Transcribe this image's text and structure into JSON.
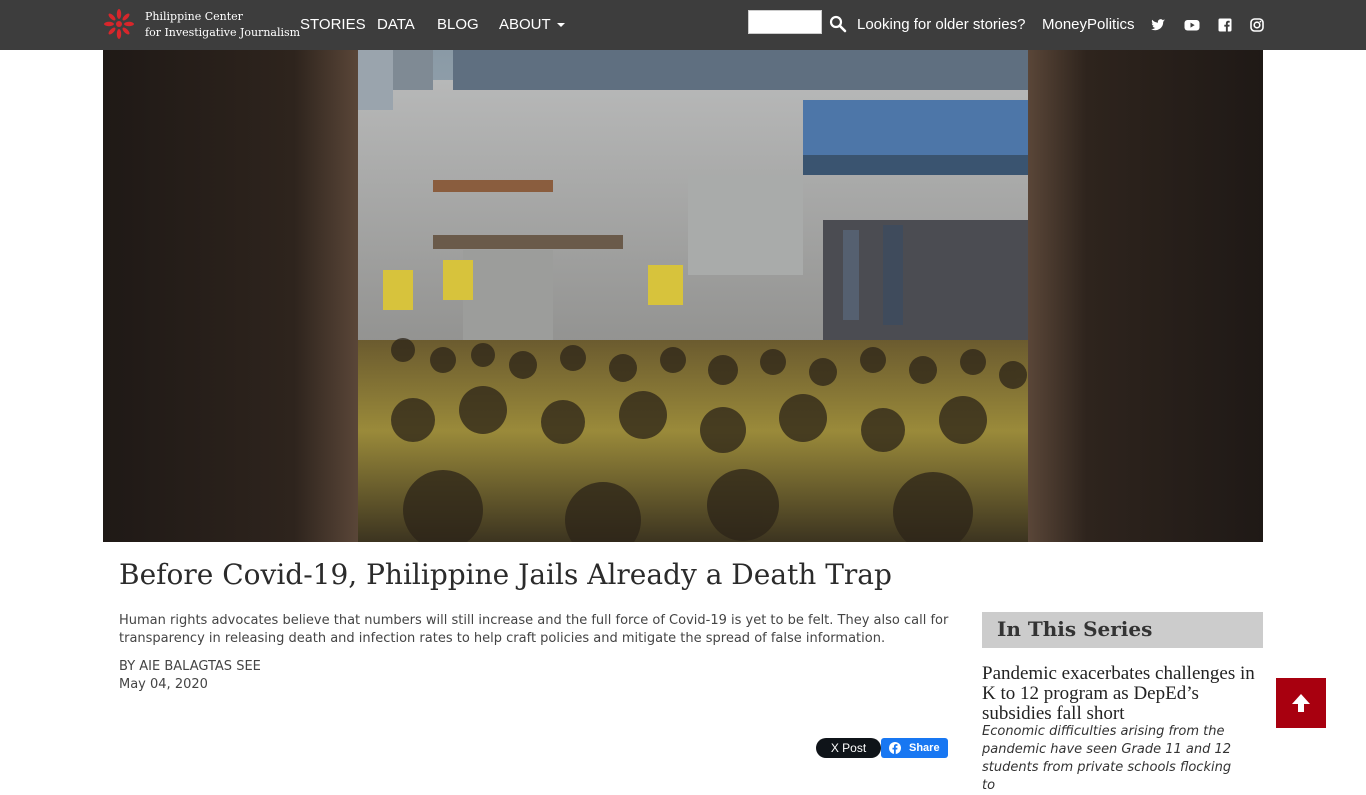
{
  "site": {
    "name_line1": "Philippine Center",
    "name_line2": "for Investigative Journalism"
  },
  "nav": {
    "stories": "STORIES",
    "data": "DATA",
    "blog": "BLOG",
    "about": "ABOUT"
  },
  "search": {
    "placeholder": ""
  },
  "header_links": {
    "older": "Looking for older stories?",
    "moneypolitics": "MoneyPolitics"
  },
  "social": [
    "twitter-icon",
    "youtube-icon",
    "facebook-icon",
    "instagram-icon"
  ],
  "article": {
    "title": "Before Covid-19, Philippine Jails Already a Death Trap",
    "summary": "Human rights advocates believe that numbers will still increase and the full force of Covid-19 is yet to be felt. They also call for transparency in releasing death and infection rates to help craft policies and mitigate the spread of false information.",
    "byline": "BY AIE BALAGTAS SEE",
    "date": "May 04, 2020"
  },
  "share": {
    "x_label": "X Post",
    "fb_label": "Share"
  },
  "series": {
    "heading": "In This Series",
    "item_title": "Pandemic exacerbates challenges in K to 12 program as DepEd’s subsidies fall short",
    "item_desc": "Economic difficulties arising from the pandemic have seen Grade 11 and 12 students from private schools flocking to"
  },
  "colors": {
    "topbar": "#3d3d3d",
    "accent": "#a8000f",
    "series_bg": "#cccccc",
    "fb": "#1877f2"
  }
}
